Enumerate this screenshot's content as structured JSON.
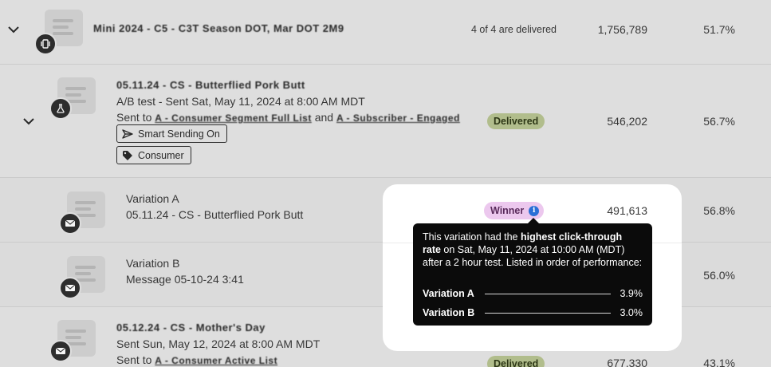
{
  "rows": [
    {
      "id": "campaign-series",
      "title": "Mini 2024 - C5 - C3T Season DOT, Mar DOT 2M9",
      "status_text": "4 of 4 are delivered",
      "recipients": "1,756,789",
      "rate": "51.7%"
    },
    {
      "id": "ab-campaign",
      "title": "05.11.24 - CS - Butterflied Pork Butt",
      "subtitle": "A/B test - Sent Sat, May 11, 2024 at 8:00 AM MDT",
      "sent_to_prefix": "Sent to",
      "list_one": "A - Consumer Segment Full List",
      "and_word": "and",
      "list_two": "A - Subscriber - Engaged",
      "tags": [
        "Smart Sending On",
        "Consumer"
      ],
      "status": "Delivered",
      "recipients": "546,202",
      "rate": "56.7%"
    },
    {
      "id": "variation-a",
      "title": "Variation A",
      "subtitle": "05.11.24 - CS - Butterflied Pork Butt",
      "status": "Winner",
      "recipients": "491,613",
      "rate": "56.8%"
    },
    {
      "id": "variation-b",
      "title": "Variation B",
      "subtitle": "Message 05-10-24 3:41",
      "rate": "56.0%"
    },
    {
      "id": "mothers-day",
      "title": "05.12.24 - CS - Mother's Day",
      "subtitle": "Sent Sun, May 12, 2024 at 8:00 AM MDT",
      "sent_to_prefix": "Sent to",
      "list_one": "A - Consumer Active List",
      "status": "Delivered",
      "recipients": "677,330",
      "rate": "43.1%"
    }
  ],
  "tooltip": {
    "intro": "This variation had the ",
    "highlight": "highest click-through rate",
    "rest": " on Sat, May 11, 2024 at 10:00 AM (MDT) after a 2 hour test. Listed in order of performance:",
    "ranking": [
      {
        "name": "Variation A",
        "value": "3.9%"
      },
      {
        "name": "Variation B",
        "value": "3.0%"
      }
    ],
    "info_glyph": "i"
  },
  "colors": {
    "delivered_pill": "#b9c592",
    "winner_pill": "#ecc8ee",
    "info_icon": "#2a6fd6",
    "tooltip_bg": "#0b0b0b"
  },
  "icons": {
    "series": "stacked-pages-icon",
    "ab_test": "flask-icon",
    "email": "envelope-icon",
    "smart_sending": "send-icon",
    "tag": "tag-icon",
    "expand": "chevron-down-icon"
  }
}
